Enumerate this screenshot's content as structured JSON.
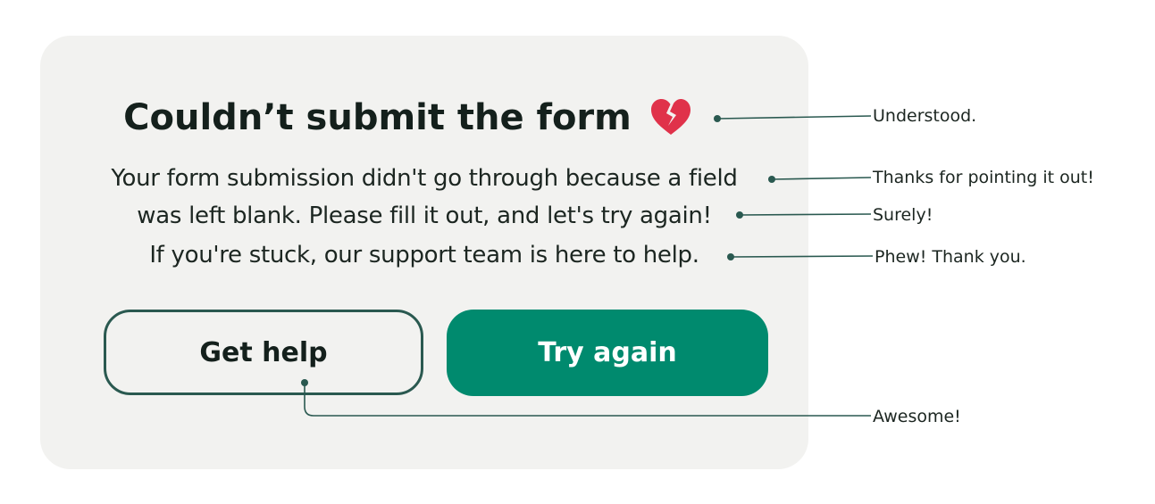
{
  "dialog": {
    "title": "Couldn’t submit the form",
    "title_icon": "broken-heart-icon",
    "body_lines": [
      "Your form submission didn't go through because a field",
      "was left blank. Please fill it out, and let's try again!",
      "If you're stuck, our support team is here to help."
    ],
    "secondary_button_label": "Get help",
    "primary_button_label": "Try again"
  },
  "annotations": [
    "Understood.",
    "Thanks for pointing it out!",
    "Surely!",
    "Phew! Thank you.",
    "Awesome!"
  ],
  "colors": {
    "card_background": "#f2f2f0",
    "primary_button": "#008a6e",
    "secondary_border": "#2a5950",
    "heart": "#e0324a",
    "leader_line": "#2a5950",
    "text": "#14201c"
  }
}
